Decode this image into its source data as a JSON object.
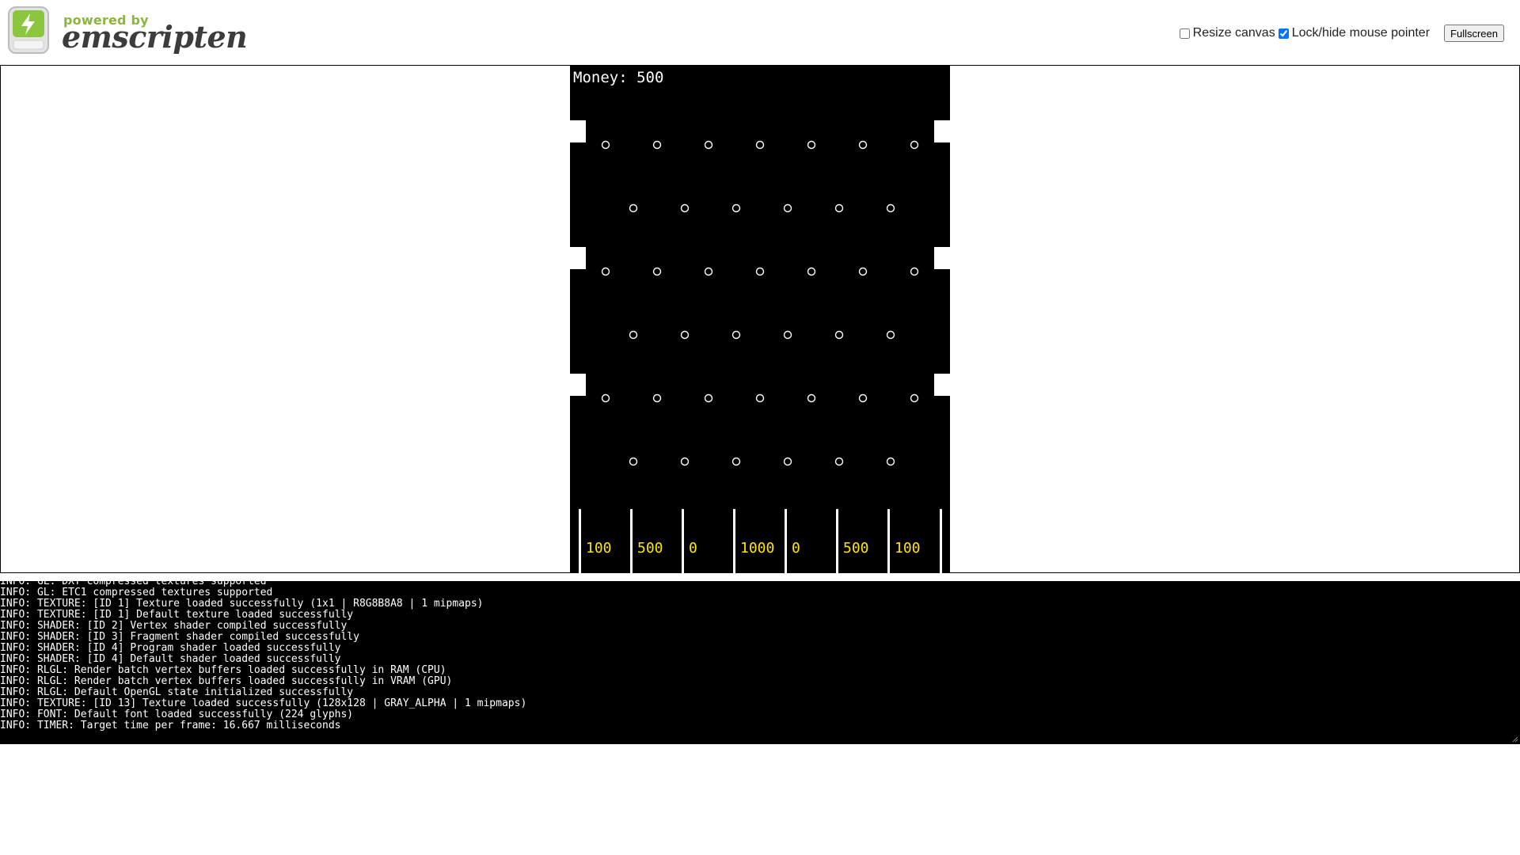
{
  "header": {
    "logo_powered_by": "powered by",
    "logo_name": "emscripten",
    "resize_canvas_label": "Resize canvas",
    "resize_canvas_checked": false,
    "lock_pointer_label": "Lock/hide mouse pointer",
    "lock_pointer_checked": true,
    "fullscreen_label": "Fullscreen"
  },
  "game": {
    "money_text": "Money: 500",
    "slot_values": [
      "100",
      "500",
      "0",
      "1000",
      "0",
      "500",
      "100"
    ],
    "colors": {
      "background": "#000000",
      "pegs": "#ffffff",
      "slot_text": "#ffe600",
      "dividers": "#ffffff"
    }
  },
  "console": {
    "lines": [
      "INFO: GL: DXT compressed textures supported",
      "INFO: GL: ETC1 compressed textures supported",
      "INFO: TEXTURE: [ID 1] Texture loaded successfully (1x1 | R8G8B8A8 | 1 mipmaps)",
      "INFO: TEXTURE: [ID 1] Default texture loaded successfully",
      "INFO: SHADER: [ID 2] Vertex shader compiled successfully",
      "INFO: SHADER: [ID 3] Fragment shader compiled successfully",
      "INFO: SHADER: [ID 4] Program shader loaded successfully",
      "INFO: SHADER: [ID 4] Default shader loaded successfully",
      "INFO: RLGL: Render batch vertex buffers loaded successfully in RAM (CPU)",
      "INFO: RLGL: Render batch vertex buffers loaded successfully in VRAM (GPU)",
      "INFO: RLGL: Default OpenGL state initialized successfully",
      "INFO: TEXTURE: [ID 13] Texture loaded successfully (128x128 | GRAY_ALPHA | 1 mipmaps)",
      "INFO: FONT: Default font loaded successfully (224 glyphs)",
      "INFO: TIMER: Target time per frame: 16.667 milliseconds"
    ]
  }
}
